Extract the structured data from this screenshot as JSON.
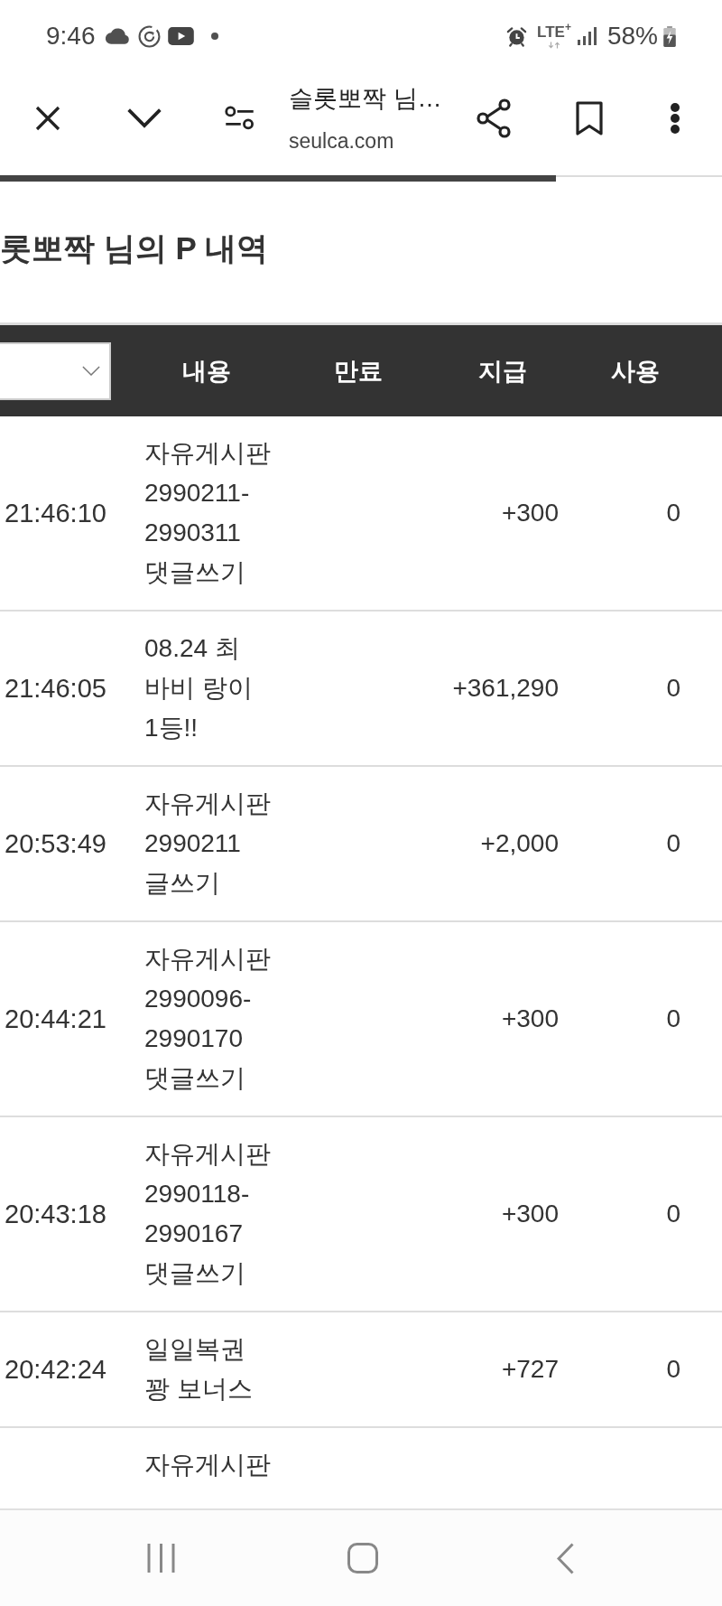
{
  "status_bar": {
    "time": "9:46",
    "network": "LTE$^{+}$",
    "battery": "58%"
  },
  "browser": {
    "title": "슬롯뽀짝 님…",
    "url": "seulca.com",
    "progress": {
      "level": 0.77
    }
  },
  "page": {
    "title": "롯뽀짝 님의 P 내역"
  },
  "table": {
    "columns": [
      "내용",
      "만료",
      "지급",
      "사용"
    ],
    "rows": [
      {
        "time": "21:46:10",
        "content": "자유게시판 2990211-2990311 댓글쓰기",
        "paid": "+300",
        "used": "0"
      },
      {
        "time": "21:46:05",
        "content": "08.24 최 바비 랑이 1등!!",
        "paid": "+361,290",
        "used": "0"
      },
      {
        "time": "20:53:49",
        "content": "자유게시판 2990211 글쓰기",
        "paid": "+2,000",
        "used": "0"
      },
      {
        "time": "20:44:21",
        "content": "자유게시판 2990096-2990170 댓글쓰기",
        "paid": "+300",
        "used": "0"
      },
      {
        "time": "20:43:18",
        "content": "자유게시판 2990118-2990167 댓글쓰기",
        "paid": "+300",
        "used": "0"
      },
      {
        "time": "20:42:24",
        "content": "일일복권 꽝 보너스",
        "paid": "+727",
        "used": "0"
      },
      {
        "content": "자유게시판"
      }
    ]
  }
}
